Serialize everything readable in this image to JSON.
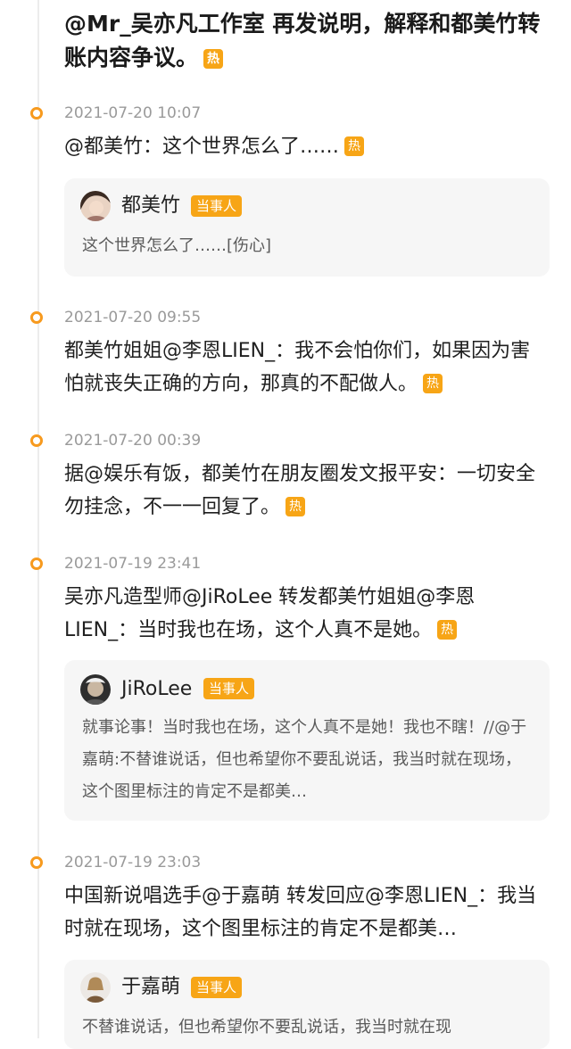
{
  "top_title": "@Mr_吴亦凡工作室 再发说明，解释和都美竹转账内容争议。",
  "hot_label": "热",
  "entries": [
    {
      "time": "2021-07-20 10:07",
      "headline": "@都美竹：这个世界怎么了……",
      "card": {
        "user": "都美竹",
        "badge": "当事人",
        "quote": "这个世界怎么了……[伤心]"
      }
    },
    {
      "time": "2021-07-20 09:55",
      "headline": "都美竹姐姐@李恩LIEN_：我不会怕你们，如果因为害怕就丧失正确的方向，那真的不配做人。"
    },
    {
      "time": "2021-07-20 00:39",
      "headline": "据@娱乐有饭，都美竹在朋友圈发文报平安：一切安全 勿挂念，不一一回复了。"
    },
    {
      "time": "2021-07-19 23:41",
      "headline": "吴亦凡造型师@JiRoLee 转发都美竹姐姐@李恩LIEN_：当时我也在场，这个人真不是她。",
      "card": {
        "user": "JiRoLee",
        "badge": "当事人",
        "quote": "就事论事！当时我也在场，这个人真不是她！我也不瞎！//@于嘉萌:不替谁说话，但也希望你不要乱说话，我当时就在现场，这个图里标注的肯定不是都美…"
      }
    },
    {
      "time": "2021-07-19 23:03",
      "headline": "中国新说唱选手@于嘉萌 转发回应@李恩LIEN_：我当时就在现场，这个图里标注的肯定不是都美…",
      "card": {
        "user": "于嘉萌",
        "badge": "当事人",
        "quote": "不替谁说话，但也希望你不要乱说话，我当时就在现"
      }
    }
  ],
  "colors": {
    "accent": "#f7a516",
    "timeline_dot": "#f79a1e",
    "card_bg": "#f6f6f6",
    "time_text": "#9a9a9a"
  }
}
